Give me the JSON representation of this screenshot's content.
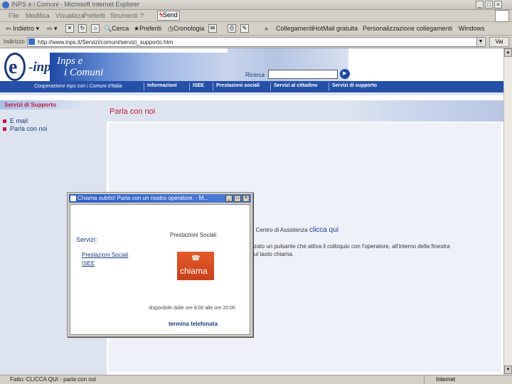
{
  "window": {
    "title": "INPS e i Comuni - Microsoft Internet Explorer",
    "buttons": {
      "minimize": "_",
      "maximize": "□",
      "close": "×"
    }
  },
  "menubar": {
    "items": [
      "File",
      "Modifica",
      "Visualizza",
      "Preferiti",
      "Strumenti",
      "?"
    ],
    "send_label": "Send"
  },
  "toolbar": {
    "back": "Indietro",
    "search": "Cerca",
    "favorites": "Preferiti",
    "history": "Cronologia",
    "chevron": "»",
    "links": [
      "Collegamenti",
      "HotMail gratuita",
      "Personalizzazione collegamenti",
      "Windows"
    ]
  },
  "address": {
    "label": "Indirizzo",
    "url": "http://www.inps.it/Servizi/comuni/servizi_supporto.htm",
    "go_label": "Vai"
  },
  "site": {
    "logo_letter": "e",
    "logo_word": "-inps",
    "brand_line1": "Inps e",
    "brand_line2": "i Comuni",
    "search_label": "Ricerca",
    "tagline": "Cooperazione Inps con i Comuni d'Italia",
    "nav": [
      "Informazioni",
      "ISEE",
      "Prestazioni sociali",
      "Servizi al cittadino",
      "Servizi di supporto"
    ]
  },
  "sidebar": {
    "heading": "Servizi di Supporto",
    "items": [
      "E mail",
      "Parla con noi"
    ]
  },
  "main": {
    "title": "Parla con noi",
    "line1_prefix": "e Centro di Assistenza",
    "click_here": "clicca qui",
    "line2": "zzato un pulsante che attiva il colloquio con l'operatore, all'interno della finestra",
    "line3": "sul tasto chiama."
  },
  "popup": {
    "title": "Chiama subito! Parla con un nostro operatore. - M...",
    "servizi_label": "Servizi:",
    "service_links": [
      "Prestazioni Sociali",
      "ISEE"
    ],
    "selected_service": "Prestazioni Sociali",
    "chiama_label": "chiama",
    "hours": "disponibile dalle ore 8:00 alle ore 20:00",
    "termina": "termina telefonata"
  },
  "status": {
    "message": "Fatto: CLICCA QUI - parla con noi",
    "zone": "Internet"
  }
}
